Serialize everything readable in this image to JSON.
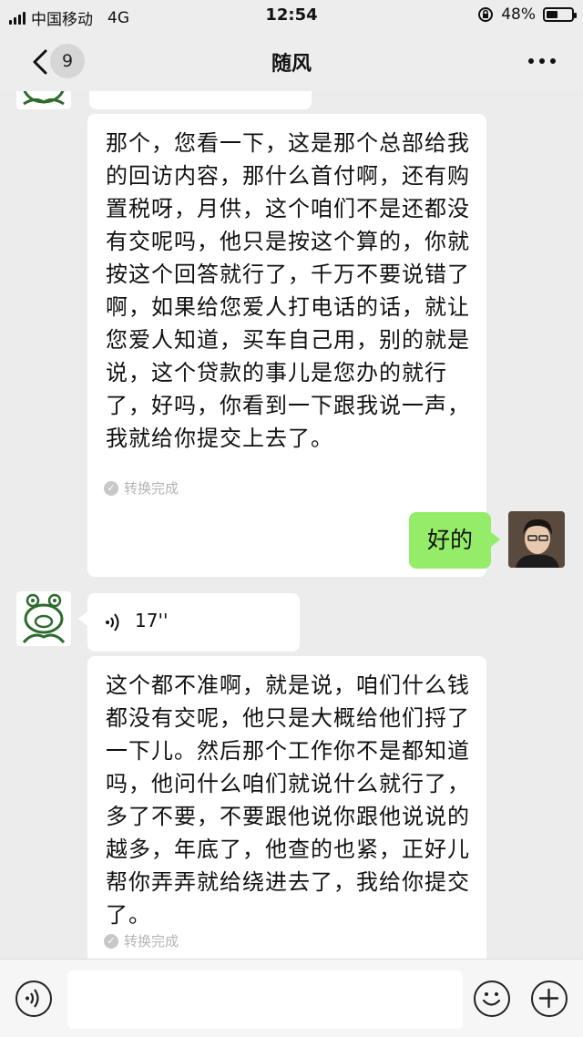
{
  "status_bar": {
    "carrier": "中国移动",
    "network": "4G",
    "time": "12:54",
    "battery_percent": "48%",
    "battery_level": 0.48
  },
  "nav": {
    "back_icon": "chevron-left-icon",
    "unread_count": "9",
    "title": "随风",
    "more_icon": "more-dots-icon"
  },
  "messages": [
    {
      "from": "other",
      "type": "voice-transcript",
      "text": "那个，您看一下，这是那个总部给我的回访内容，那什么首付啊，还有购置税呀，月供，这个咱们不是还都没有交呢吗，他只是按这个算的，你就按这个回答就行了，千万不要说错了啊，如果给您爱人打电话的话，就让您爱人知道，买车自己用，别的就是说，这个贷款的事儿是您办的就行了，好吗，你看到一下跟我说一声，我就给你提交上去了。",
      "status": "转换完成"
    },
    {
      "from": "self",
      "type": "text",
      "text": "好的"
    },
    {
      "from": "other",
      "type": "voice",
      "duration": "17''"
    },
    {
      "from": "other",
      "type": "voice-transcript",
      "text": "这个都不准啊，就是说，咱们什么钱都没有交呢，他只是大概给他们捋了一下儿。然后那个工作你不是都知道吗，他问什么咱们就说什么就行了，多了不要，不要跟他说你跟他说说的越多，年底了，他查的也紧，正好儿帮你弄弄就给绕进去了，我给你提交了。",
      "status": "转换完成"
    }
  ],
  "input_bar": {
    "voice_icon": "voice-input-icon",
    "emoji_icon": "emoji-icon",
    "plus_icon": "plus-icon",
    "placeholder": ""
  },
  "colors": {
    "background": "#ececec",
    "self_bubble": "#95ec69",
    "other_bubble": "#ffffff",
    "frog_green": "#2e6b2e"
  }
}
